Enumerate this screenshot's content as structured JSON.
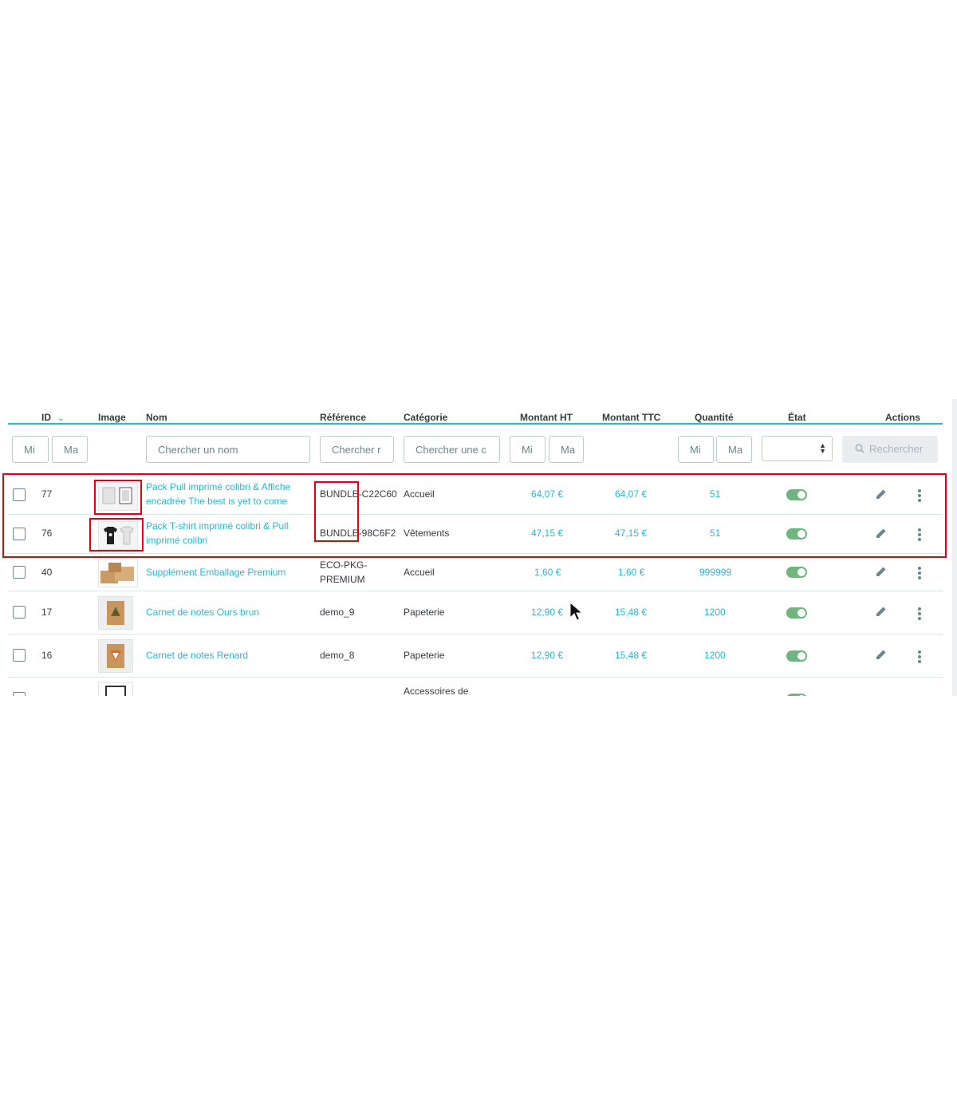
{
  "table": {
    "headers": {
      "id": "ID",
      "image": "Image",
      "name": "Nom",
      "reference": "Référence",
      "category": "Catégorie",
      "price_ht": "Montant HT",
      "price_ttc": "Montant TTC",
      "quantity": "Quantité",
      "status": "État",
      "actions": "Actions"
    },
    "filters": {
      "id_min": "Mi",
      "id_max": "Ma",
      "name": "Chercher un nom",
      "reference": "Chercher r",
      "category": "Chercher une c",
      "price_min": "Mi",
      "price_max": "Ma",
      "qty_min": "Mi",
      "qty_max": "Ma",
      "status_select": "",
      "search_button": "Rechercher"
    },
    "rows": [
      {
        "id": "77",
        "name": "Pack Pull imprimé colibri & Affiche encadrée The best is yet to come",
        "reference": "BUNDLE-C22C60",
        "category": "Accueil",
        "price_ht": "64,07 €",
        "price_ttc": "64,07 €",
        "quantity": "51",
        "active": true,
        "image": "pull-and-frame-thumbnail"
      },
      {
        "id": "76",
        "name": "Pack T-shirt imprimé colibri & Pull imprimé colibri",
        "reference": "BUNDLE-98C6F2",
        "category": "Vêtements",
        "price_ht": "47,15 €",
        "price_ttc": "47,15 €",
        "quantity": "51",
        "active": true,
        "image": "tshirt-and-pull-thumbnail"
      },
      {
        "id": "40",
        "name": "Supplément Emballage Premium",
        "reference": "ECO-PKG-PREMIUM",
        "category": "Accueil",
        "price_ht": "1,60 €",
        "price_ttc": "1,60 €",
        "quantity": "999999",
        "active": true,
        "image": "cardboard-box-thumbnail"
      },
      {
        "id": "17",
        "name": "Carnet de notes Ours brun",
        "reference": "demo_9",
        "category": "Papeterie",
        "price_ht": "12,90 €",
        "price_ttc": "15,48 €",
        "quantity": "1200",
        "active": true,
        "image": "notebook-bear-thumbnail"
      },
      {
        "id": "16",
        "name": "Carnet de notes Renard",
        "reference": "demo_8",
        "category": "Papeterie",
        "price_ht": "12,90 €",
        "price_ttc": "15,48 €",
        "quantity": "1200",
        "active": true,
        "image": "notebook-fox-thumbnail"
      },
      {
        "id": "",
        "name": "",
        "reference": "",
        "category": "Accessoires de",
        "price_ht": "",
        "price_ttc": "",
        "quantity": "",
        "active": true,
        "image": "framed-poster-thumbnail"
      }
    ]
  },
  "colors": {
    "accent": "#25b9d7",
    "toggle_on": "#70b580",
    "highlight": "#e4000f",
    "text": "#363a41",
    "muted": "#6c868e"
  },
  "icons": [
    "sort-desc-icon",
    "search-icon",
    "edit-pencil-icon",
    "more-vertical-icon",
    "select-arrows-icon",
    "mouse-cursor-icon"
  ]
}
